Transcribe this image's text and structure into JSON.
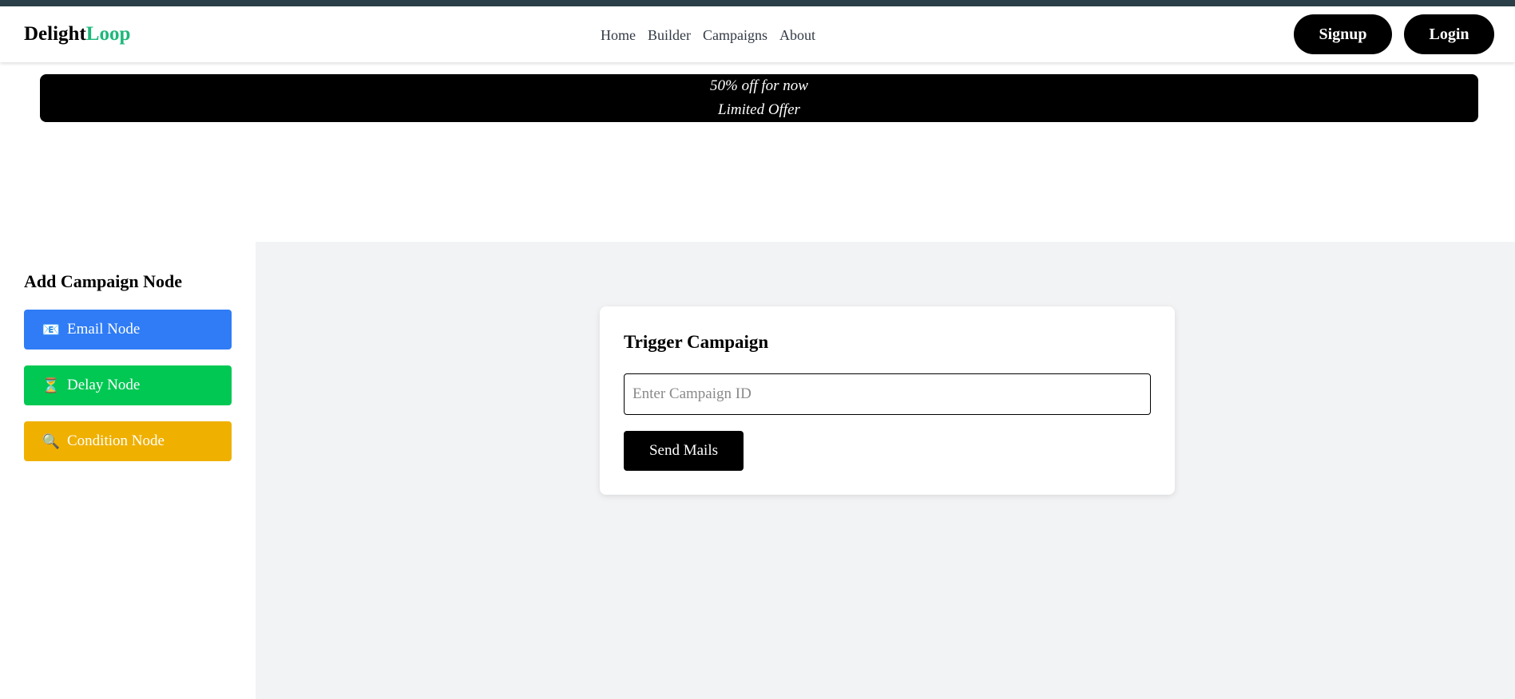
{
  "brand": {
    "part1": "Delight",
    "part2": "Loop",
    "accent_color": "#1fb77a"
  },
  "nav": {
    "links": [
      "Home",
      "Builder",
      "Campaigns",
      "About"
    ],
    "signup_label": "Signup",
    "login_label": "Login"
  },
  "banner": {
    "line1": "50% off for now",
    "line2": "Limited Offer"
  },
  "sidebar": {
    "title": "Add Campaign Node",
    "nodes": [
      {
        "icon": "envelope-icon",
        "glyph": "📧",
        "label": "Email Node",
        "color": "#2f7cf6"
      },
      {
        "icon": "hourglass-icon",
        "glyph": "⏳",
        "label": "Delay Node",
        "color": "#00c853"
      },
      {
        "icon": "magnifier-icon",
        "glyph": "🔍",
        "label": "Condition Node",
        "color": "#f0b000"
      }
    ]
  },
  "trigger": {
    "title": "Trigger Campaign",
    "input_placeholder": "Enter Campaign ID",
    "input_value": "",
    "send_label": "Send Mails"
  }
}
